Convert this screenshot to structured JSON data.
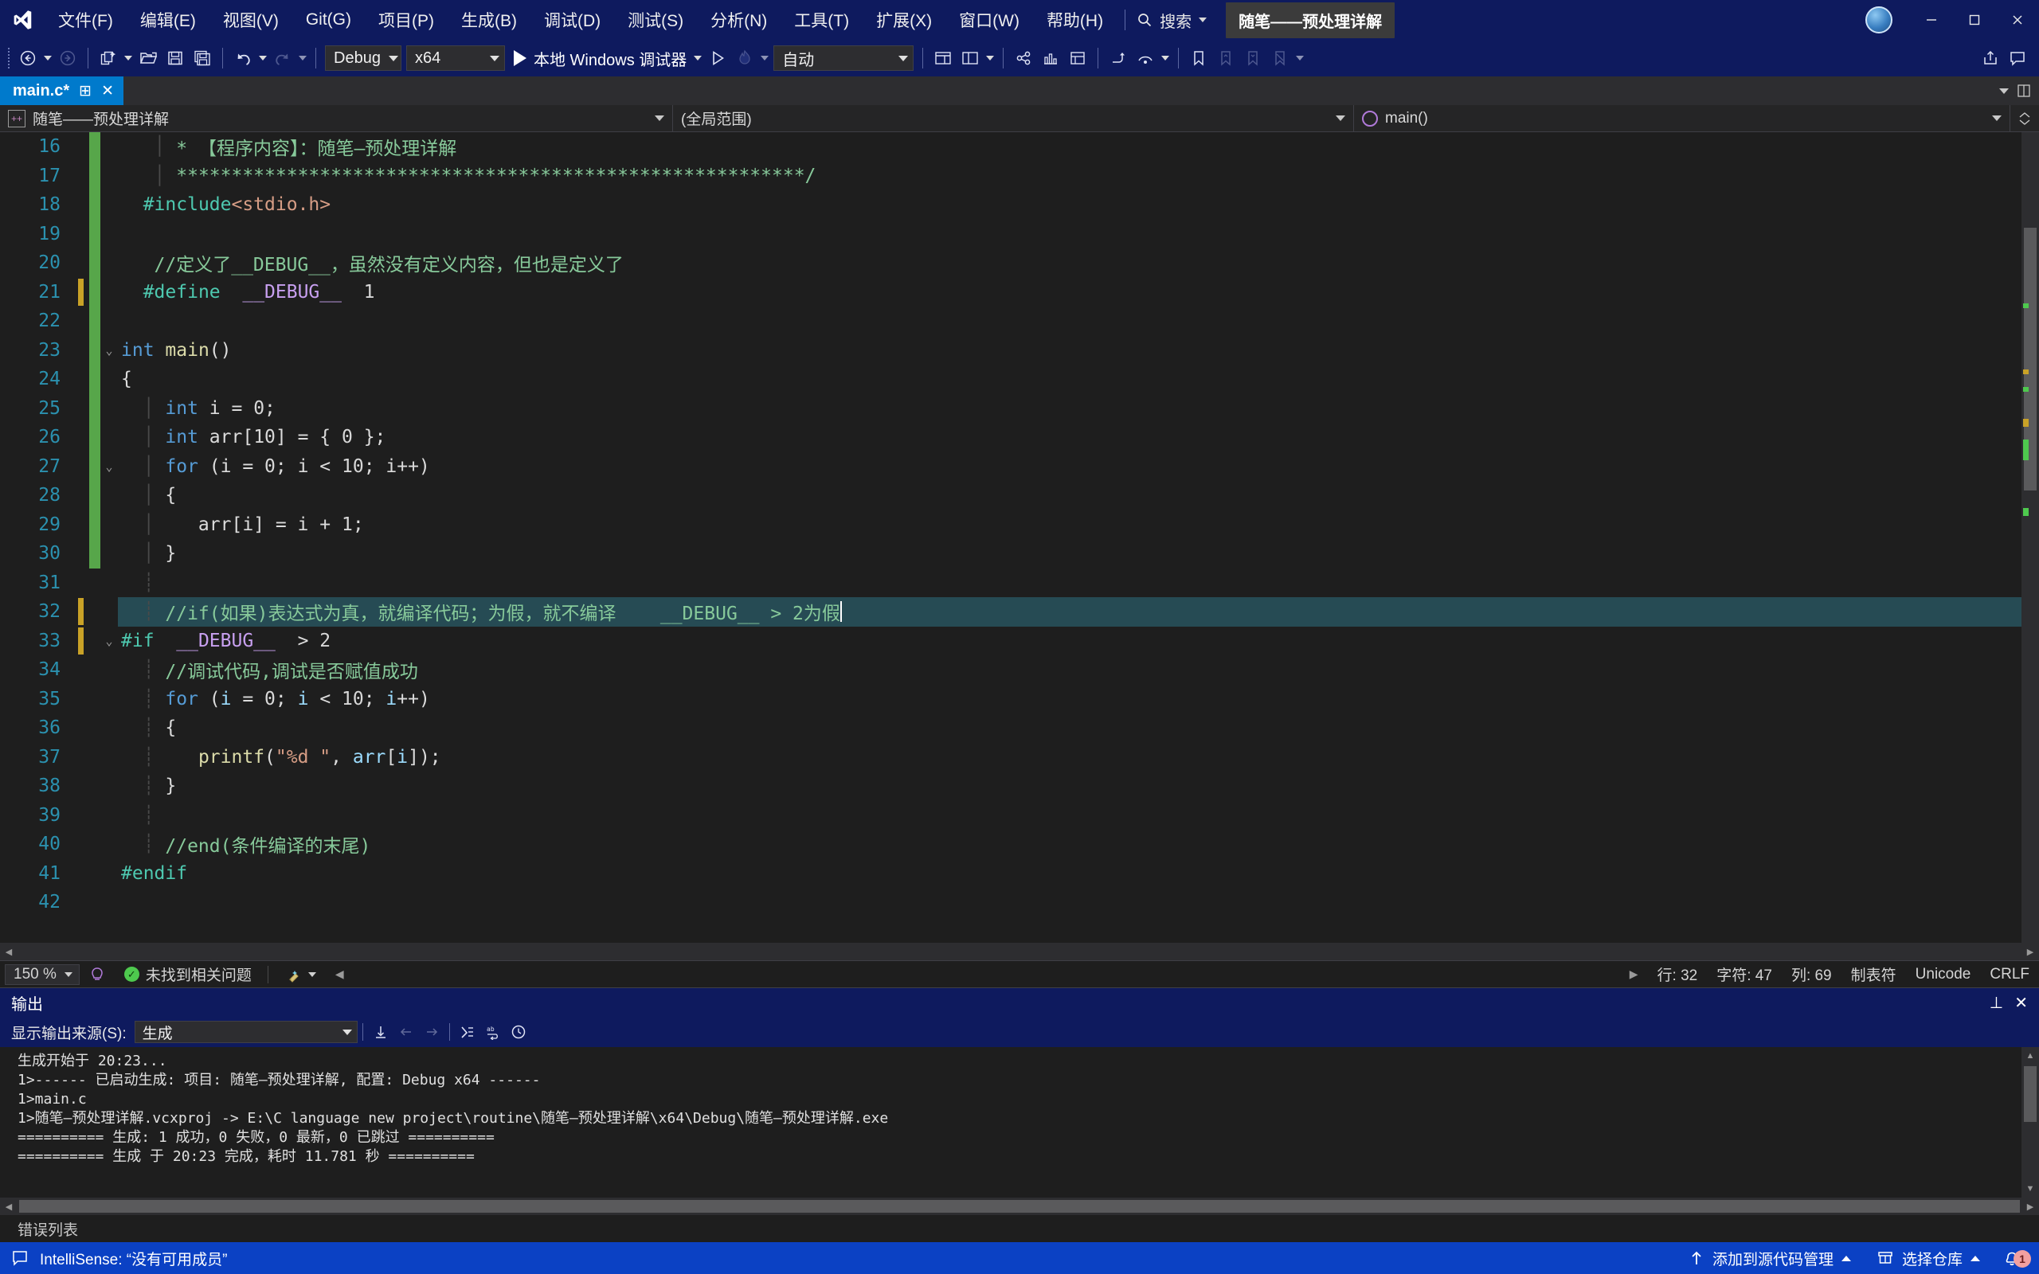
{
  "titlebar": {
    "logo_icon": "visual-studio-logo",
    "menus": [
      {
        "label": "文件(F)"
      },
      {
        "label": "编辑(E)"
      },
      {
        "label": "视图(V)"
      },
      {
        "label": "Git(G)"
      },
      {
        "label": "项目(P)"
      },
      {
        "label": "生成(B)"
      },
      {
        "label": "调试(D)"
      },
      {
        "label": "测试(S)"
      },
      {
        "label": "分析(N)"
      },
      {
        "label": "工具(T)"
      },
      {
        "label": "扩展(X)"
      },
      {
        "label": "窗口(W)"
      },
      {
        "label": "帮助(H)"
      }
    ],
    "search_label": "搜索",
    "project_chip": "随笔——预处理详解",
    "window_min": "minimize",
    "window_max": "maximize",
    "window_close": "close"
  },
  "toolbar": {
    "nav_back": "后退",
    "nav_forward": "前进",
    "new_item": "新建项",
    "open_file": "打开文件",
    "save": "保存",
    "save_all": "全部保存",
    "undo": "撤销",
    "redo": "重做",
    "config": "Debug",
    "platform": "x64",
    "run_label": "本地 Windows 调试器",
    "auto_label": "自动"
  },
  "tabs": {
    "active": "main.c*",
    "pin_glyph": "⊞",
    "close_glyph": "✕"
  },
  "navbar": {
    "project": "随笔——预处理详解",
    "scope": "(全局范围)",
    "member": "main()"
  },
  "code": {
    "lines": [
      {
        "n": "16",
        "marker": "green",
        "bp": "",
        "fold": "",
        "cur": false,
        "tokens": [
          {
            "t": "   ",
            "c": "pl"
          },
          {
            "t": "│ ",
            "c": "indent-guide"
          },
          {
            "t": "* 【程序内容】：随笔—预处理详解",
            "c": "cmt"
          }
        ]
      },
      {
        "n": "17",
        "marker": "green",
        "bp": "",
        "fold": "",
        "cur": false,
        "tokens": [
          {
            "t": "   ",
            "c": "pl"
          },
          {
            "t": "│ ",
            "c": "indent-guide"
          },
          {
            "t": "*********************************************************/",
            "c": "cmt"
          }
        ]
      },
      {
        "n": "18",
        "marker": "green",
        "bp": "",
        "fold": "",
        "cur": false,
        "tokens": [
          {
            "t": "  ",
            "c": "pl"
          },
          {
            "t": "#include",
            "c": "pp"
          },
          {
            "t": "<stdio.h>",
            "c": "str"
          }
        ]
      },
      {
        "n": "19",
        "marker": "green",
        "bp": "",
        "fold": "",
        "cur": false,
        "tokens": []
      },
      {
        "n": "20",
        "marker": "green",
        "bp": "",
        "fold": "",
        "cur": false,
        "tokens": [
          {
            "t": "   //定义了__DEBUG__，虽然没有定义内容，但也是定义了",
            "c": "cmt"
          }
        ]
      },
      {
        "n": "21",
        "marker": "green",
        "bp": "chg",
        "fold": "",
        "cur": false,
        "tokens": [
          {
            "t": "  ",
            "c": "pl"
          },
          {
            "t": "#define",
            "c": "pp"
          },
          {
            "t": "  ",
            "c": "pl"
          },
          {
            "t": "__DEBUG__",
            "c": "mac"
          },
          {
            "t": "  1",
            "c": "num"
          }
        ]
      },
      {
        "n": "22",
        "marker": "green",
        "bp": "",
        "fold": "",
        "cur": false,
        "tokens": []
      },
      {
        "n": "23",
        "marker": "green",
        "bp": "",
        "fold": "v",
        "cur": false,
        "tokens": [
          {
            "t": "int",
            "c": "kw"
          },
          {
            "t": " ",
            "c": "pl"
          },
          {
            "t": "main",
            "c": "fn"
          },
          {
            "t": "()",
            "c": "pl"
          }
        ]
      },
      {
        "n": "24",
        "marker": "green",
        "bp": "",
        "fold": "",
        "cur": false,
        "tokens": [
          {
            "t": "{",
            "c": "pl"
          }
        ]
      },
      {
        "n": "25",
        "marker": "green",
        "bp": "",
        "fold": "",
        "cur": false,
        "tokens": [
          {
            "t": "  │ ",
            "c": "indent-guide"
          },
          {
            "t": "int",
            "c": "kw"
          },
          {
            "t": " i = ",
            "c": "pl"
          },
          {
            "t": "0",
            "c": "num"
          },
          {
            "t": ";",
            "c": "pl"
          }
        ]
      },
      {
        "n": "26",
        "marker": "green",
        "bp": "",
        "fold": "",
        "cur": false,
        "tokens": [
          {
            "t": "  │ ",
            "c": "indent-guide"
          },
          {
            "t": "int",
            "c": "kw"
          },
          {
            "t": " arr[",
            "c": "pl"
          },
          {
            "t": "10",
            "c": "num"
          },
          {
            "t": "] = { ",
            "c": "pl"
          },
          {
            "t": "0",
            "c": "num"
          },
          {
            "t": " };",
            "c": "pl"
          }
        ]
      },
      {
        "n": "27",
        "marker": "green",
        "bp": "",
        "fold": "v",
        "cur": false,
        "tokens": [
          {
            "t": "  │ ",
            "c": "indent-guide"
          },
          {
            "t": "for",
            "c": "kw"
          },
          {
            "t": " (i = ",
            "c": "pl"
          },
          {
            "t": "0",
            "c": "num"
          },
          {
            "t": "; i < ",
            "c": "pl"
          },
          {
            "t": "10",
            "c": "num"
          },
          {
            "t": "; i++)",
            "c": "pl"
          }
        ]
      },
      {
        "n": "28",
        "marker": "green",
        "bp": "",
        "fold": "",
        "cur": false,
        "tokens": [
          {
            "t": "  │ ",
            "c": "indent-guide"
          },
          {
            "t": "{",
            "c": "pl"
          }
        ]
      },
      {
        "n": "29",
        "marker": "green",
        "bp": "",
        "fold": "",
        "cur": false,
        "tokens": [
          {
            "t": "  │ ",
            "c": "indent-guide"
          },
          {
            "t": "   arr[i] = i + ",
            "c": "pl"
          },
          {
            "t": "1",
            "c": "num"
          },
          {
            "t": ";",
            "c": "pl"
          }
        ]
      },
      {
        "n": "30",
        "marker": "green",
        "bp": "",
        "fold": "",
        "cur": false,
        "tokens": [
          {
            "t": "  │ ",
            "c": "indent-guide"
          },
          {
            "t": "}",
            "c": "pl"
          }
        ]
      },
      {
        "n": "31",
        "marker": "none",
        "bp": "",
        "fold": "",
        "cur": false,
        "tokens": [
          {
            "t": "  ┊ ",
            "c": "indent-guide"
          }
        ]
      },
      {
        "n": "32",
        "marker": "none",
        "bp": "chg",
        "fold": "",
        "cur": true,
        "tokens": [
          {
            "t": "  ┊ ",
            "c": "indent-guide"
          },
          {
            "t": "//if(如果)表达式为真，就编译代码；为假，就不编译    __DEBUG__ > 2为假",
            "c": "cmt"
          }
        ]
      },
      {
        "n": "33",
        "marker": "none",
        "bp": "chg",
        "fold": "v",
        "cur": false,
        "tokens": [
          {
            "t": "#if",
            "c": "pp"
          },
          {
            "t": "  ",
            "c": "pl"
          },
          {
            "t": "__DEBUG__",
            "c": "mac"
          },
          {
            "t": "  > ",
            "c": "pl"
          },
          {
            "t": "2",
            "c": "num"
          }
        ]
      },
      {
        "n": "34",
        "marker": "none",
        "bp": "",
        "fold": "",
        "cur": false,
        "tokens": [
          {
            "t": "  ┊ ",
            "c": "indent-guide"
          },
          {
            "t": "//调试代码,调试是否赋值成功",
            "c": "cmt"
          }
        ]
      },
      {
        "n": "35",
        "marker": "none",
        "bp": "",
        "fold": "",
        "cur": false,
        "tokens": [
          {
            "t": "  ┊ ",
            "c": "indent-guide"
          },
          {
            "t": "for",
            "c": "kw"
          },
          {
            "t": " (",
            "c": "pl"
          },
          {
            "t": "i",
            "c": "id"
          },
          {
            "t": " = ",
            "c": "pl"
          },
          {
            "t": "0",
            "c": "num"
          },
          {
            "t": "; ",
            "c": "pl"
          },
          {
            "t": "i",
            "c": "id"
          },
          {
            "t": " < ",
            "c": "pl"
          },
          {
            "t": "10",
            "c": "num"
          },
          {
            "t": "; ",
            "c": "pl"
          },
          {
            "t": "i",
            "c": "id"
          },
          {
            "t": "++)",
            "c": "pl"
          }
        ]
      },
      {
        "n": "36",
        "marker": "none",
        "bp": "",
        "fold": "",
        "cur": false,
        "tokens": [
          {
            "t": "  ┊ ",
            "c": "indent-guide"
          },
          {
            "t": "{",
            "c": "pl"
          }
        ]
      },
      {
        "n": "37",
        "marker": "none",
        "bp": "",
        "fold": "",
        "cur": false,
        "tokens": [
          {
            "t": "  ┊ ",
            "c": "indent-guide"
          },
          {
            "t": "   ",
            "c": "pl"
          },
          {
            "t": "printf",
            "c": "fn"
          },
          {
            "t": "(",
            "c": "pl"
          },
          {
            "t": "\"%d \"",
            "c": "str"
          },
          {
            "t": ", ",
            "c": "pl"
          },
          {
            "t": "arr",
            "c": "id"
          },
          {
            "t": "[",
            "c": "pl"
          },
          {
            "t": "i",
            "c": "id"
          },
          {
            "t": "]);",
            "c": "pl"
          }
        ]
      },
      {
        "n": "38",
        "marker": "none",
        "bp": "",
        "fold": "",
        "cur": false,
        "tokens": [
          {
            "t": "  ┊ ",
            "c": "indent-guide"
          },
          {
            "t": "}",
            "c": "pl"
          }
        ]
      },
      {
        "n": "39",
        "marker": "none",
        "bp": "",
        "fold": "",
        "cur": false,
        "tokens": [
          {
            "t": "  ┊ ",
            "c": "indent-guide"
          }
        ]
      },
      {
        "n": "40",
        "marker": "none",
        "bp": "",
        "fold": "",
        "cur": false,
        "tokens": [
          {
            "t": "  ┊ ",
            "c": "indent-guide"
          },
          {
            "t": "//end(条件编译的末尾)",
            "c": "cmt"
          }
        ]
      },
      {
        "n": "41",
        "marker": "none",
        "bp": "",
        "fold": "",
        "cur": false,
        "tokens": [
          {
            "t": "#endif",
            "c": "pp"
          }
        ]
      },
      {
        "n": "42",
        "marker": "none",
        "bp": "",
        "fold": "",
        "cur": false,
        "tokens": []
      }
    ]
  },
  "editor_status": {
    "zoom": "150 %",
    "problems": "未找到相关问题",
    "line_label": "行: 32",
    "char_label": "字符: 47",
    "col_label": "列: 69",
    "tab_label": "制表符",
    "encoding": "Unicode",
    "eol": "CRLF"
  },
  "output": {
    "title": "输出",
    "source_label": "显示输出来源(S):",
    "source_value": "生成",
    "pin_glyph": "⊥",
    "close_glyph": "✕",
    "lines": [
      "生成开始于 20:23...",
      "1>------ 已启动生成: 项目: 随笔—预处理详解, 配置: Debug x64 ------",
      "1>main.c",
      "1>随笔—预处理详解.vcxproj -> E:\\C language new project\\routine\\随笔—预处理详解\\x64\\Debug\\随笔—预处理详解.exe",
      "========== 生成: 1 成功，0 失败，0 最新，0 已跳过 ==========",
      "========== 生成 于 20:23 完成，耗时 11.781 秒 =========="
    ],
    "bottom_tab": "错误列表"
  },
  "statusbar": {
    "message": "IntelliSense: “没有可用成员”",
    "source_control": "添加到源代码管理",
    "select_repo": "选择仓库",
    "notification_count": "1"
  },
  "colors": {
    "title_bar": "#0e1a5e",
    "status_bar": "#0b41c4",
    "active_tab": "#007acc",
    "editor_bg": "#1e1e1e",
    "current_line": "#264b54",
    "line_number": "#2b91af",
    "comment": "#87c99a",
    "keyword": "#569cd6",
    "preprocessor": "#4ec9b0",
    "macro": "#c8a0f0",
    "string": "#d69d85",
    "function": "#dcdcaa",
    "changed_marker": "#c9a227",
    "saved_marker": "#57a64a"
  }
}
